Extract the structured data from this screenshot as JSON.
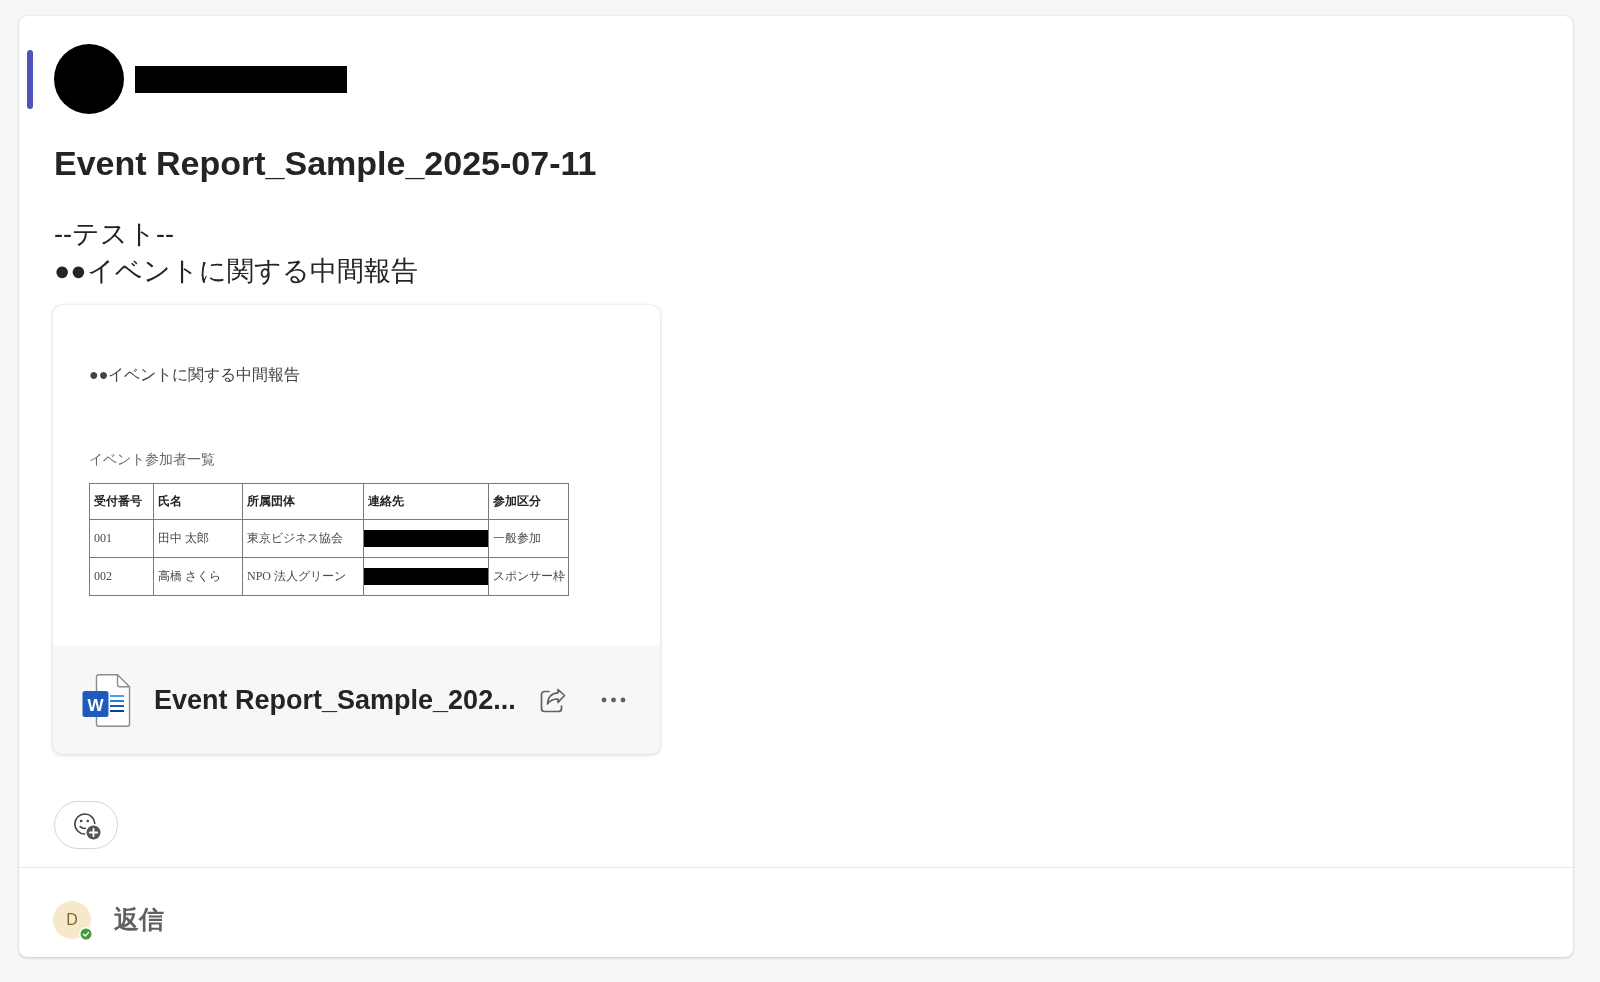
{
  "message": {
    "author": {
      "redacted": true
    },
    "title": "Event Report_Sample_2025-07-11",
    "body_lines": [
      "--テスト--",
      "●●イベントに関する中間報告"
    ],
    "attachment": {
      "preview": {
        "heading": "●●イベントに関する中間報告",
        "subheading": "イベント参加者一覧",
        "table": {
          "columns": [
            "受付番号",
            "氏名",
            "所属団体",
            "連絡先",
            "参加区分"
          ],
          "rows": [
            [
              {
                "kind": "text",
                "text": "001"
              },
              {
                "kind": "text",
                "text": "田中 太郎"
              },
              {
                "kind": "text",
                "text": "東京ビジネス協会"
              },
              {
                "kind": "redacted"
              },
              {
                "kind": "text",
                "text": "一般参加"
              }
            ],
            [
              {
                "kind": "text",
                "text": "002"
              },
              {
                "kind": "text",
                "text": "高橋 さくら"
              },
              {
                "kind": "text",
                "text": "NPO 法人グリーン"
              },
              {
                "kind": "redacted"
              },
              {
                "kind": "text",
                "text": "スポンサー枠"
              }
            ]
          ]
        }
      },
      "file": {
        "kind": "word",
        "icon_letter": "W",
        "name": "Event Report_Sample_202..."
      }
    }
  },
  "reply": {
    "avatar_initial": "D",
    "available": true,
    "label": "返信"
  }
}
